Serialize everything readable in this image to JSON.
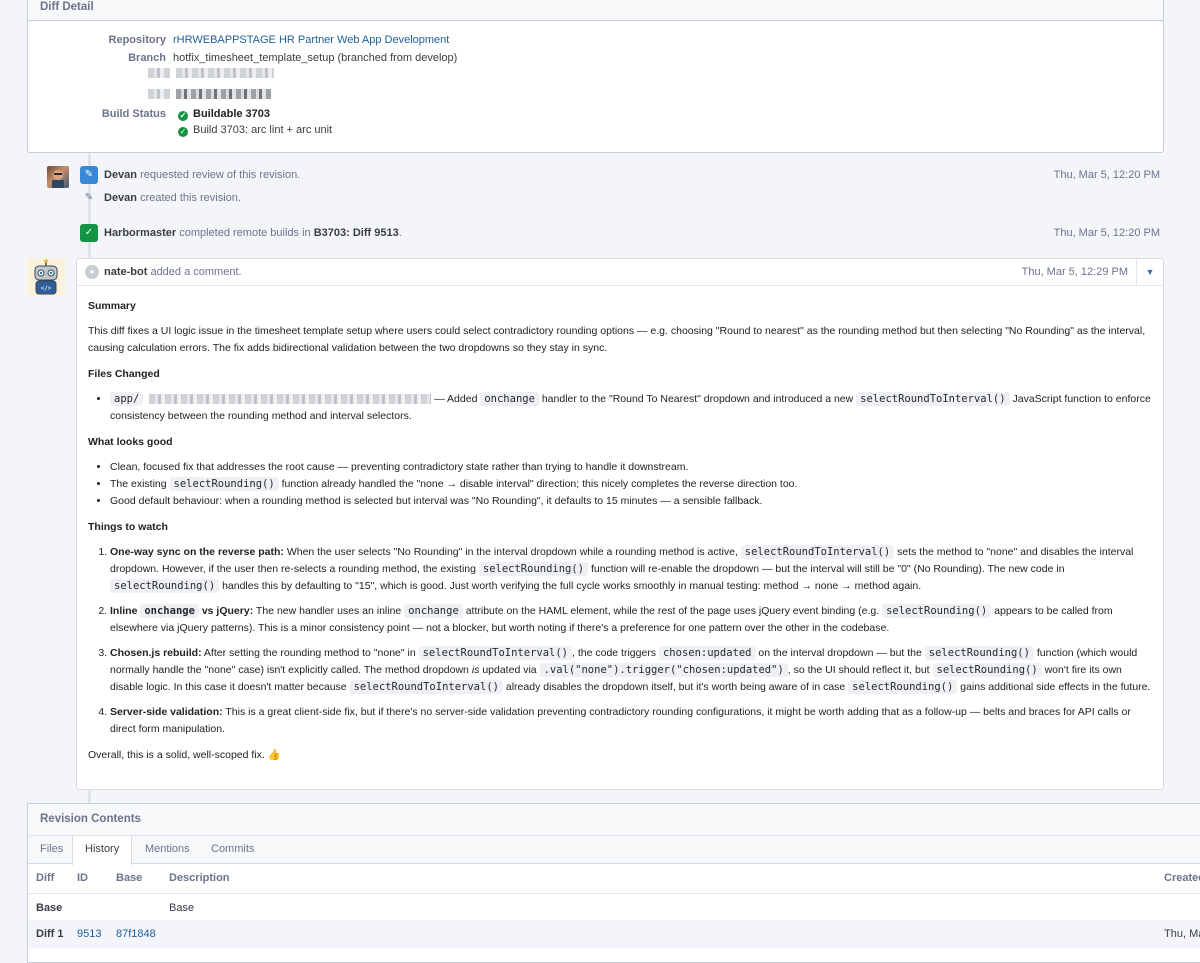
{
  "diff_detail": {
    "title": "Diff Detail",
    "repository_label": "Repository",
    "repository_value": "rHRWEBAPPSTAGE HR Partner Web App Development",
    "branch_label": "Branch",
    "branch_value": "hotfix_timesheet_template_setup (branched from develop)",
    "build_status_label": "Build Status",
    "build_items": [
      "Buildable 3703",
      "Build 3703: arc lint + arc unit"
    ]
  },
  "timeline": {
    "events": [
      {
        "actor": "Devan",
        "action": " requested review of this revision.",
        "date": "Thu, Mar 5, 12:20 PM"
      },
      {
        "actor": "Devan",
        "action": " created this revision.",
        "date": ""
      },
      {
        "actor": "Harbormaster",
        "action": " completed remote builds in ",
        "link": "B3703: Diff 9513",
        "suffix": ".",
        "date": "Thu, Mar 5, 12:20 PM"
      }
    ]
  },
  "comment": {
    "author": "nate-bot",
    "action": " added a comment.",
    "date": "Thu, Mar 5, 12:29 PM",
    "summary_h": "Summary",
    "summary": "This diff fixes a UI logic issue in the timesheet template setup where users could select contradictory rounding options — e.g. choosing \"Round to nearest\" as the rounding method but then selecting \"No Rounding\" as the interval, causing calculation errors. The fix adds bidirectional validation between the two dropdowns so they stay in sync.",
    "files_h": "Files Changed",
    "file_prefix": "app/",
    "file_desc_a": " — Added ",
    "file_code_1": "onchange",
    "file_desc_b": " handler to the \"Round To Nearest\" dropdown and introduced a new ",
    "file_code_2": "selectRoundToInterval()",
    "file_desc_c": " JavaScript function to enforce consistency between the rounding method and interval selectors.",
    "good_h": "What looks good",
    "good_1": "Clean, focused fix that addresses the root cause — preventing contradictory state rather than trying to handle it downstream.",
    "good_2a": "The existing ",
    "good_2code": "selectRounding()",
    "good_2b": " function already handled the \"none → disable interval\" direction; this nicely completes the reverse direction too.",
    "good_3": "Good default behaviour: when a rounding method is selected but interval was \"No Rounding\", it defaults to 15 minutes — a sensible fallback.",
    "watch_h": "Things to watch",
    "w1_title": "One-way sync on the reverse path:",
    "w1_a": " When the user selects \"No Rounding\" in the interval dropdown while a rounding method is active, ",
    "w1_c1": "selectRoundToInterval()",
    "w1_b": " sets the method to \"none\" and disables the interval dropdown. However, if the user then re-selects a rounding method, the existing ",
    "w1_c2": "selectRounding()",
    "w1_c": " function will re-enable the dropdown — but the interval will still be \"0\" (No Rounding). The new code in ",
    "w1_c3": "selectRounding()",
    "w1_d": " handles this by defaulting to \"15\", which is good. Just worth verifying the full cycle works smoothly in manual testing: method → none → method again.",
    "w2_title_a": "Inline ",
    "w2_title_code": "onchange",
    "w2_title_b": " vs jQuery:",
    "w2_a": " The new handler uses an inline ",
    "w2_c1": "onchange",
    "w2_b": " attribute on the HAML element, while the rest of the page uses jQuery event binding (e.g. ",
    "w2_c2": "selectRounding()",
    "w2_c": " appears to be called from elsewhere via jQuery patterns). This is a minor consistency point — not a blocker, but worth noting if there's a preference for one pattern over the other in the codebase.",
    "w3_title": "Chosen.js rebuild:",
    "w3_a": " After setting the rounding method to \"none\" in ",
    "w3_c1": "selectRoundToInterval()",
    "w3_b": ", the code triggers ",
    "w3_c2": "chosen:updated",
    "w3_c": " on the interval dropdown — but the ",
    "w3_c3": "selectRounding()",
    "w3_d": " function (which would normally handle the \"none\" case) isn't explicitly called. The method dropdown ",
    "w3_is": "is",
    "w3_e": " updated via ",
    "w3_c4": ".val(\"none\").trigger(\"chosen:updated\")",
    "w3_f": ", so the UI should reflect it, but ",
    "w3_c5": "selectRounding()",
    "w3_g": " won't fire its own disable logic. In this case it doesn't matter because ",
    "w3_c6": "selectRoundToInterval()",
    "w3_h": " already disables the dropdown itself, but it's worth being aware of in case ",
    "w3_c7": "selectRounding()",
    "w3_i": " gains additional side effects in the future.",
    "w4_title": "Server-side validation:",
    "w4_a": " This is a great client-side fix, but if there's no server-side validation preventing contradictory rounding configurations, it might be worth adding that as a follow-up — belts and braces for API calls or direct form manipulation.",
    "closing": "Overall, this is a solid, well-scoped fix. 👍"
  },
  "revision": {
    "title": "Revision Contents",
    "tabs": [
      "Files",
      "History",
      "Mentions",
      "Commits"
    ],
    "active_tab": "History",
    "columns": [
      "Diff",
      "ID",
      "Base",
      "Description",
      "Created"
    ],
    "rows": [
      {
        "diff": "Base",
        "id": "",
        "base": "",
        "description": "Base",
        "created": ""
      },
      {
        "diff": "Diff 1",
        "id": "9513",
        "base": "87f1848",
        "description": "",
        "created": "Thu, Ma"
      }
    ]
  },
  "colors": {
    "accent": "#1f5f98",
    "success": "#139543",
    "edit_icon": "#3a87d6"
  }
}
